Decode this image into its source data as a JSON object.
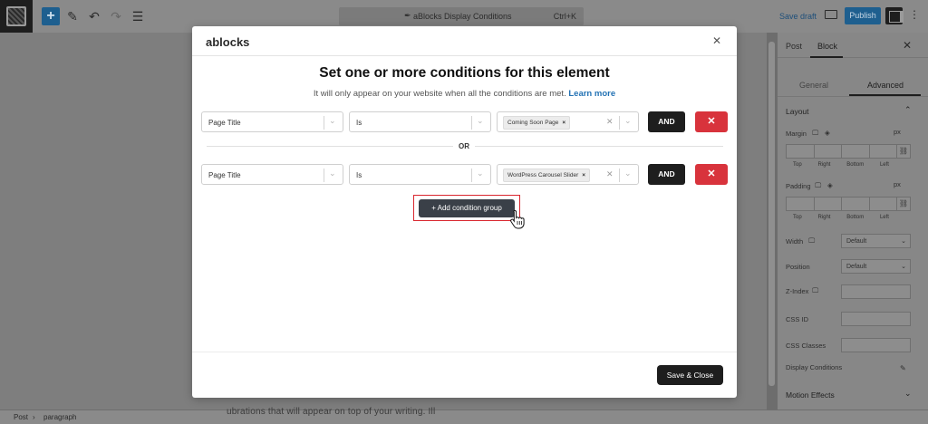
{
  "toolbar": {
    "command_title": "aBlocks Display Conditions",
    "command_shortcut": "Ctrl+K",
    "save_draft": "Save draft",
    "publish": "Publish"
  },
  "canvas": {
    "ghost_text": "ubrations that will appear on top of your writing. Ill"
  },
  "settings": {
    "tab_post": "Post",
    "tab_block": "Block",
    "subtab_general": "General",
    "subtab_advanced": "Advanced",
    "layout": "Layout",
    "margin": "Margin",
    "padding": "Padding",
    "unit": "px",
    "sides": [
      "Top",
      "Right",
      "Bottom",
      "Left"
    ],
    "width": "Width",
    "width_value": "Default",
    "position": "Position",
    "position_value": "Default",
    "zindex": "Z-Index",
    "css_id": "CSS ID",
    "css_classes": "CSS Classes",
    "display_conditions": "Display Conditions",
    "motion_effects": "Motion Effects"
  },
  "statusbar": {
    "post": "Post",
    "paragraph": "paragraph"
  },
  "modal": {
    "brand": "ablocks",
    "title": "Set one or more conditions for this element",
    "subtitle": "It will only appear on your website when all the conditions are met.",
    "learn_more": "Learn more",
    "or_label": "OR",
    "rows": [
      {
        "field": "Page Title",
        "operator": "Is",
        "value": "Coming Soon Page",
        "and": "AND"
      },
      {
        "field": "Page Title",
        "operator": "Is",
        "value": "WordPress Carousel Slider",
        "and": "AND"
      }
    ],
    "add_group": "+ Add condition group",
    "save_close": "Save & Close"
  },
  "colors": {
    "accent_blue": "#2372b4",
    "danger_red": "#d8333c",
    "dark_button": "#1e1e1e"
  }
}
